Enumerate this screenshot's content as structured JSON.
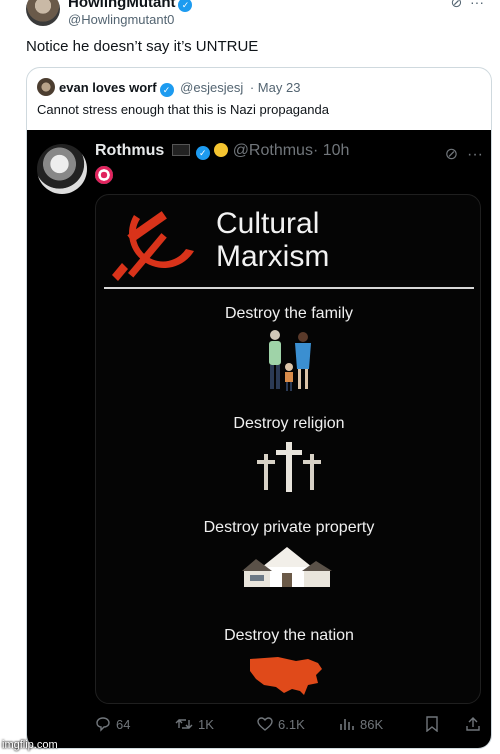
{
  "outer_tweet": {
    "name": "HowlingMutant",
    "handle": "@Howlingmutant0",
    "text": "Notice he doesn’t say it’s UNTRUE"
  },
  "quoted_tweet": {
    "name": "evan loves worf",
    "handle": "@esjesjesj",
    "date": "· May 23",
    "text": "Cannot stress enough that this is Nazi propaganda"
  },
  "screenshot_tweet": {
    "name": "Rothmus",
    "handle": "@Rothmus",
    "time": "· 10h",
    "meme": {
      "title_line1": "Cultural",
      "title_line2": "Marxism",
      "captions": [
        "Destroy the family",
        "Destroy religion",
        "Destroy private property",
        "Destroy the nation"
      ]
    },
    "actions": {
      "replies": "64",
      "reposts": "1K",
      "likes": "6.1K",
      "views": "86K"
    }
  },
  "watermark": "imgflip.com",
  "colors": {
    "verified": "#1d9bf0",
    "hammer_sickle": "#d9331a",
    "map": "#e04a1a"
  }
}
